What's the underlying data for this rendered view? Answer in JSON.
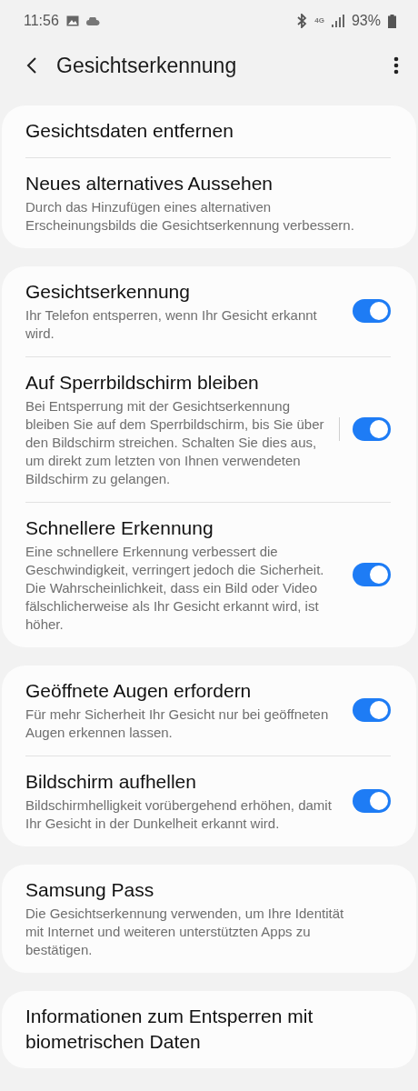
{
  "status_bar": {
    "time": "11:56",
    "network": "4G",
    "battery": "93%"
  },
  "header": {
    "title": "Gesichtserkennung"
  },
  "cards": [
    {
      "items": [
        {
          "kind": "text",
          "title": "Gesichtsdaten entfernen"
        },
        {
          "kind": "text",
          "title": "Neues alternatives Aussehen",
          "description": "Durch das Hinzufügen eines alternativen Erscheinungsbilds die Gesichtserkennung verbessern."
        }
      ]
    },
    {
      "items": [
        {
          "kind": "switch",
          "title": "Gesichtserkennung",
          "description": "Ihr Telefon entsperren, wenn Ihr Gesicht erkannt wird.",
          "on": true
        },
        {
          "kind": "split-switch",
          "title": "Auf Sperrbildschirm bleiben",
          "description": "Bei Entsperrung mit der Gesichtserkennung bleiben Sie auf dem Sperrbildschirm, bis Sie über den Bildschirm streichen. Schalten Sie dies aus, um direkt zum letzten von Ihnen verwendeten Bildschirm zu gelangen.",
          "on": true
        },
        {
          "kind": "switch",
          "title": "Schnellere Erkennung",
          "description": "Eine schnellere Erkennung verbessert die Geschwindigkeit, verringert jedoch die Sicherheit. Die Wahrscheinlichkeit, dass ein Bild oder Video fälschlicherweise als Ihr Gesicht erkannt wird, ist höher.",
          "on": true
        }
      ]
    },
    {
      "items": [
        {
          "kind": "switch",
          "title": "Geöffnete Augen erfordern",
          "description": "Für mehr Sicherheit Ihr Gesicht nur bei geöffneten Augen erkennen lassen.",
          "on": true
        },
        {
          "kind": "switch",
          "title": "Bildschirm aufhellen",
          "description": "Bildschirmhelligkeit vorübergehend erhöhen, damit Ihr Gesicht in der Dunkelheit erkannt wird.",
          "on": true
        }
      ]
    },
    {
      "items": [
        {
          "kind": "text",
          "title": "Samsung Pass",
          "description": "Die Gesichtserkennung verwenden, um Ihre Identität mit Internet und weiteren unterstützten Apps zu bestätigen."
        }
      ]
    },
    {
      "items": [
        {
          "kind": "text",
          "title": "Informationen zum Entsperren mit biometrischen Daten"
        }
      ]
    }
  ]
}
